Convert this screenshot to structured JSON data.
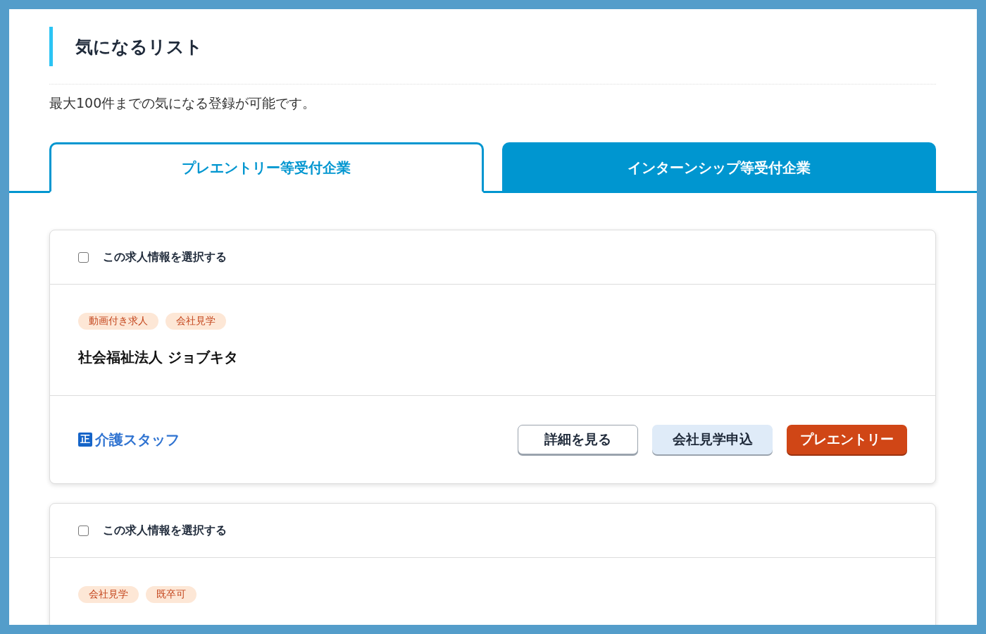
{
  "page": {
    "title": "気になるリスト",
    "description": "最大100件までの気になる登録が可能です。"
  },
  "tabs": [
    {
      "label": "プレエントリー等受付企業",
      "selected": true
    },
    {
      "label": "インターンシップ等受付企業",
      "selected": false
    }
  ],
  "cards": [
    {
      "select": {
        "label": "この求人情報を選択する",
        "checked": false
      },
      "tags": [
        "動画付き求人",
        "会社見学"
      ],
      "company": "社会福祉法人 ジョブキタ",
      "job": {
        "badge": "正",
        "title": "介護スタッフ"
      },
      "buttons": [
        {
          "label": "詳細を見る",
          "kind": "outline"
        },
        {
          "label": "会社見学申込",
          "kind": "light"
        },
        {
          "label": "プレエントリー",
          "kind": "primary"
        }
      ]
    },
    {
      "select": {
        "label": "この求人情報を選択する",
        "checked": false
      },
      "tags": [
        "会社見学",
        "既卒可"
      ]
    }
  ]
}
